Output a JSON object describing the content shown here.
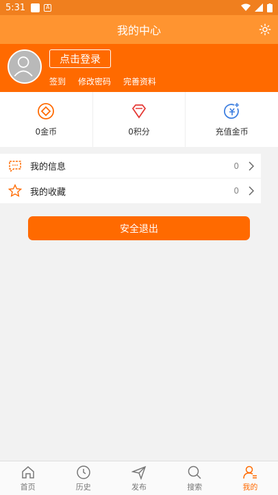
{
  "status": {
    "time": "5:31"
  },
  "header": {
    "title": "我的中心"
  },
  "profile": {
    "login_label": "点击登录",
    "links": [
      "签到",
      "修改密码",
      "完善资料"
    ]
  },
  "stats": [
    {
      "label": "0金币",
      "icon": "coin-icon"
    },
    {
      "label": "0积分",
      "icon": "diamond-icon"
    },
    {
      "label": "充值金币",
      "icon": "recharge-icon"
    }
  ],
  "menu": [
    {
      "label": "我的信息",
      "count": "0",
      "icon": "message-icon"
    },
    {
      "label": "我的收藏",
      "count": "0",
      "icon": "star-icon"
    }
  ],
  "logout_label": "安全退出",
  "tabs": [
    {
      "label": "首页",
      "icon": "home-icon"
    },
    {
      "label": "历史",
      "icon": "clock-icon"
    },
    {
      "label": "发布",
      "icon": "send-icon"
    },
    {
      "label": "搜索",
      "icon": "search-icon"
    },
    {
      "label": "我的",
      "icon": "user-icon",
      "active": true
    }
  ],
  "colors": {
    "accent": "#ff6a00",
    "header": "#ff9430"
  }
}
